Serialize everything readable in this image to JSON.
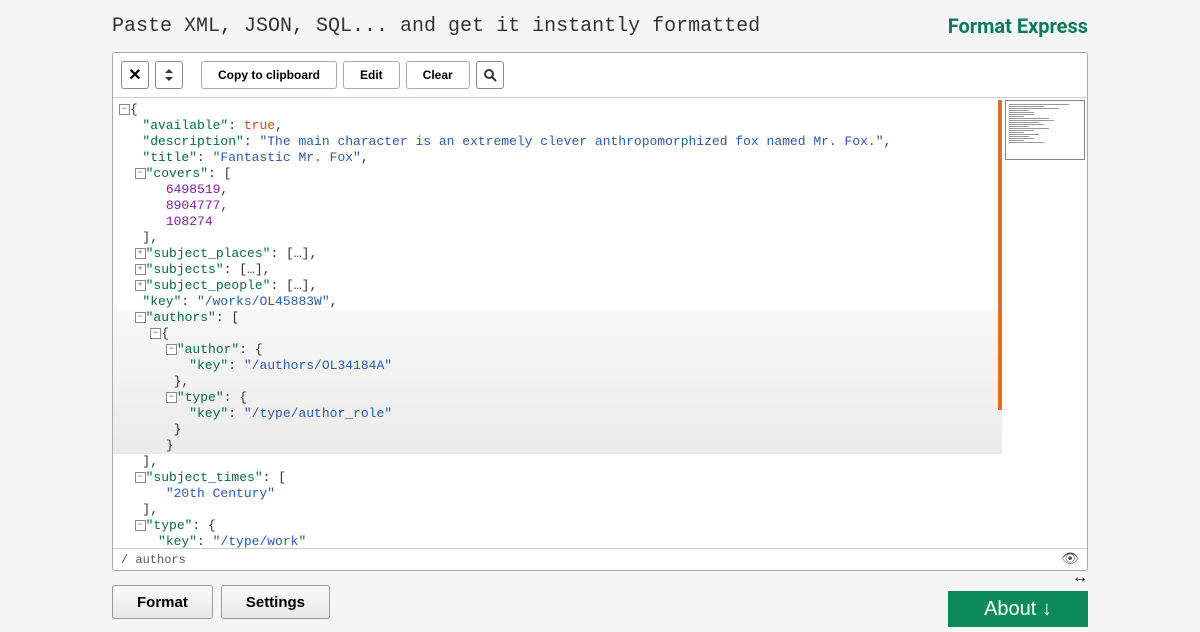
{
  "header": {
    "tagline": "Paste XML, JSON, SQL... and get it instantly formatted",
    "brand": "Format Express"
  },
  "toolbar": {
    "copy": "Copy to clipboard",
    "edit": "Edit",
    "clear": "Clear"
  },
  "code": {
    "l1": "{",
    "k_available": "\"available\"",
    "v_available": "true",
    "k_description": "\"description\"",
    "v_description": "\"The main character is an extremely clever anthropomorphized fox named Mr. Fox.\"",
    "k_title": "\"title\"",
    "v_title": "\"Fantastic Mr. Fox\"",
    "k_covers": "\"covers\"",
    "cover1": "6498519",
    "cover2": "8904777",
    "cover3": "108274",
    "k_subject_places": "\"subject_places\"",
    "k_subjects": "\"subjects\"",
    "k_subject_people": "\"subject_people\"",
    "ellipsis_array": "[…]",
    "k_key": "\"key\"",
    "v_key": "\"/works/OL45883W\"",
    "k_authors": "\"authors\"",
    "k_author": "\"author\"",
    "v_author_key": "\"/authors/OL34184A\"",
    "k_type": "\"type\"",
    "v_type_key": "\"/type/author_role\"",
    "k_subject_times": "\"subject_times\"",
    "v_century": "\"20th Century\"",
    "v_type_work": "\"/type/work\""
  },
  "breadcrumb": "/ authors",
  "footer": {
    "format": "Format",
    "settings": "Settings",
    "about": "About ↓"
  }
}
